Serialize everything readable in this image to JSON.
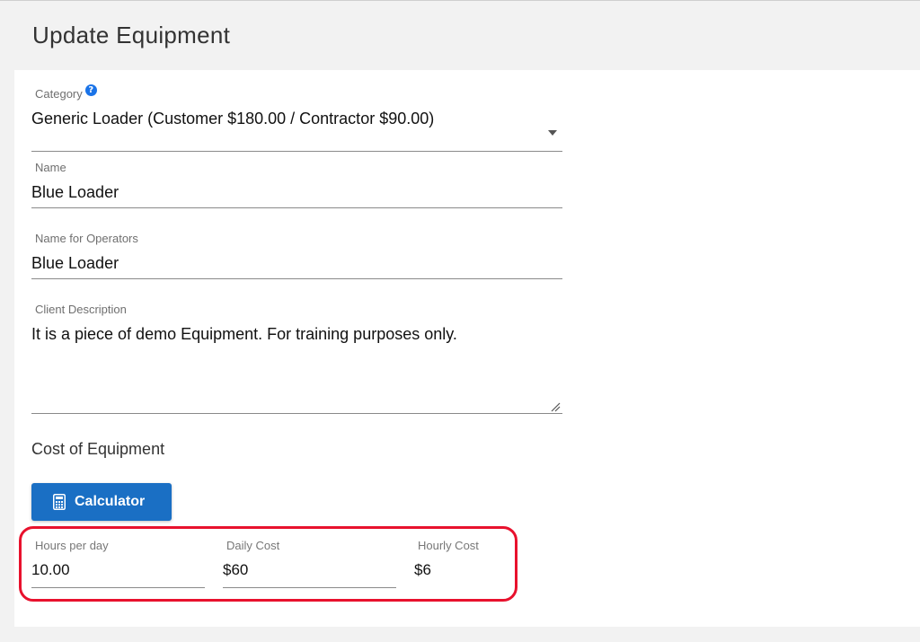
{
  "header": {
    "title": "Update Equipment"
  },
  "form": {
    "category": {
      "label": "Category",
      "value": "Generic Loader (Customer $180.00 / Contractor $90.00)",
      "help_icon": "question-circle-icon"
    },
    "name": {
      "label": "Name",
      "value": "Blue Loader"
    },
    "operator_name": {
      "label": "Name for Operators",
      "value": "Blue Loader"
    },
    "client_description": {
      "label": "Client Description",
      "value": "It is a piece of demo Equipment. For training purposes only."
    }
  },
  "cost": {
    "section_title": "Cost of Equipment",
    "calculator_label": "Calculator",
    "calculator_icon": "calculator-icon",
    "hours_per_day": {
      "label": "Hours per day",
      "value": "10.00"
    },
    "daily_cost": {
      "label": "Daily Cost",
      "value": "$60"
    },
    "hourly_cost": {
      "label": "Hourly Cost",
      "value": "$6"
    }
  },
  "colors": {
    "accent": "#1a6fc4",
    "highlight": "#e8112d",
    "help_icon": "#1a73e8"
  }
}
